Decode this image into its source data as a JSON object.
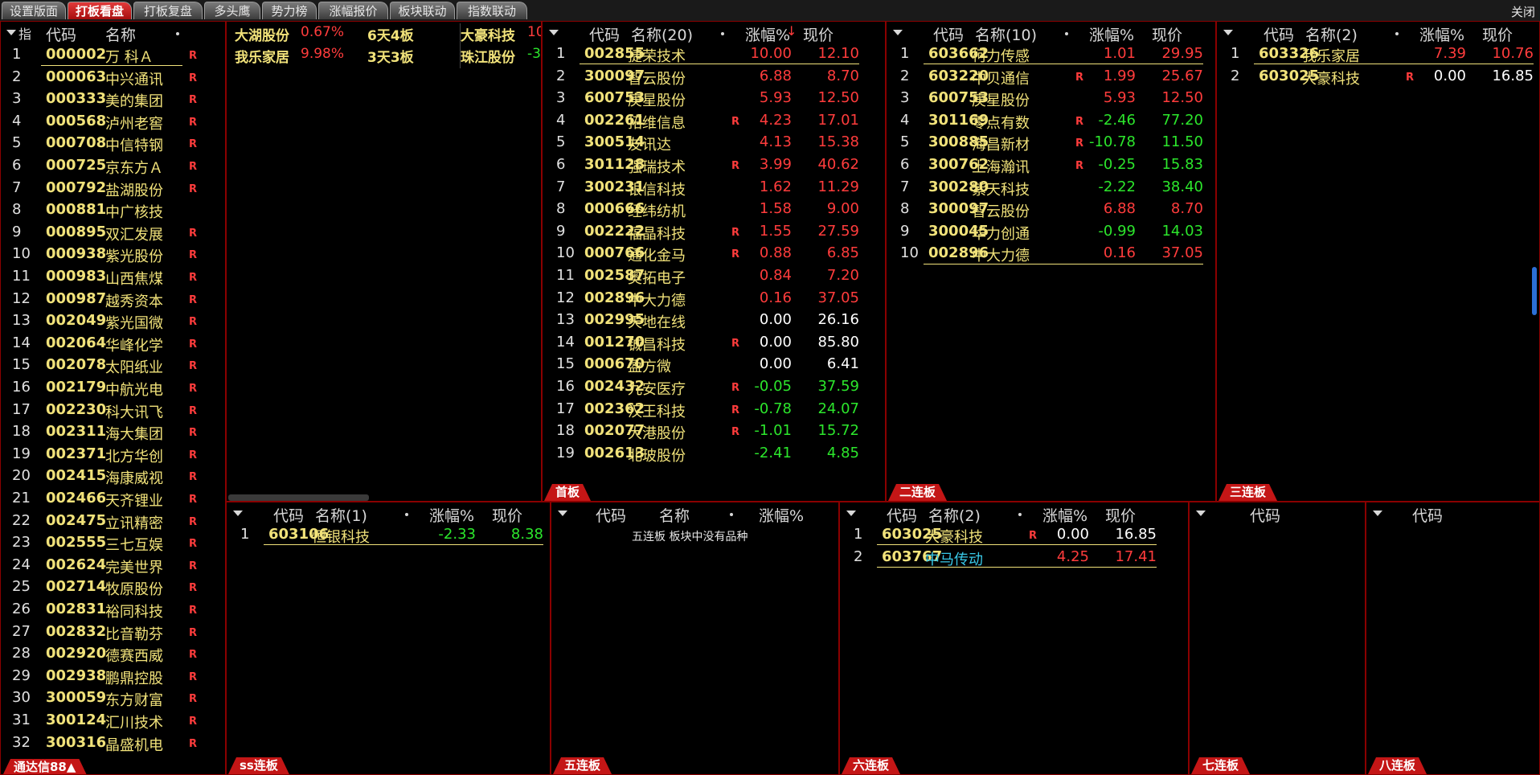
{
  "tabs": [
    "设置版面",
    "打板看盘",
    "打板复盘",
    "多头鹰",
    "势力榜",
    "涨幅报价",
    "板块联动",
    "指数联动"
  ],
  "close_label": "关闭",
  "left_list": {
    "hdr_idx": "指",
    "hdr_code": "代码",
    "hdr_name": "名称",
    "rows": [
      {
        "i": "1",
        "code": "000002",
        "name": "万 科Ａ",
        "r": "R"
      },
      {
        "i": "2",
        "code": "000063",
        "name": "中兴通讯",
        "r": "R"
      },
      {
        "i": "3",
        "code": "000333",
        "name": "美的集团",
        "r": "R"
      },
      {
        "i": "4",
        "code": "000568",
        "name": "泸州老窖",
        "r": "R"
      },
      {
        "i": "5",
        "code": "000708",
        "name": "中信特钢",
        "r": "R"
      },
      {
        "i": "6",
        "code": "000725",
        "name": "京东方Ａ",
        "r": "R"
      },
      {
        "i": "7",
        "code": "000792",
        "name": "盐湖股份",
        "r": "R"
      },
      {
        "i": "8",
        "code": "000881",
        "name": "中广核技",
        "r": ""
      },
      {
        "i": "9",
        "code": "000895",
        "name": "双汇发展",
        "r": "R"
      },
      {
        "i": "10",
        "code": "000938",
        "name": "紫光股份",
        "r": "R"
      },
      {
        "i": "11",
        "code": "000983",
        "name": "山西焦煤",
        "r": "R"
      },
      {
        "i": "12",
        "code": "000987",
        "name": "越秀资本",
        "r": "R"
      },
      {
        "i": "13",
        "code": "002049",
        "name": "紫光国微",
        "r": "R"
      },
      {
        "i": "14",
        "code": "002064",
        "name": "华峰化学",
        "r": "R"
      },
      {
        "i": "15",
        "code": "002078",
        "name": "太阳纸业",
        "r": "R"
      },
      {
        "i": "16",
        "code": "002179",
        "name": "中航光电",
        "r": "R"
      },
      {
        "i": "17",
        "code": "002230",
        "name": "科大讯飞",
        "r": "R"
      },
      {
        "i": "18",
        "code": "002311",
        "name": "海大集团",
        "r": "R"
      },
      {
        "i": "19",
        "code": "002371",
        "name": "北方华创",
        "r": "R"
      },
      {
        "i": "20",
        "code": "002415",
        "name": "海康威视",
        "r": "R"
      },
      {
        "i": "21",
        "code": "002466",
        "name": "天齐锂业",
        "r": "R"
      },
      {
        "i": "22",
        "code": "002475",
        "name": "立讯精密",
        "r": "R"
      },
      {
        "i": "23",
        "code": "002555",
        "name": "三七互娱",
        "r": "R"
      },
      {
        "i": "24",
        "code": "002624",
        "name": "完美世界",
        "r": "R"
      },
      {
        "i": "25",
        "code": "002714",
        "name": "牧原股份",
        "r": "R"
      },
      {
        "i": "26",
        "code": "002831",
        "name": "裕同科技",
        "r": "R"
      },
      {
        "i": "27",
        "code": "002832",
        "name": "比音勒芬",
        "r": "R"
      },
      {
        "i": "28",
        "code": "002920",
        "name": "德赛西威",
        "r": "R"
      },
      {
        "i": "29",
        "code": "002938",
        "name": "鹏鼎控股",
        "r": "R"
      },
      {
        "i": "30",
        "code": "300059",
        "name": "东方财富",
        "r": "R"
      },
      {
        "i": "31",
        "code": "300124",
        "name": "汇川技术",
        "r": "R"
      },
      {
        "i": "32",
        "code": "300316",
        "name": "晶盛机电",
        "r": "R"
      }
    ],
    "footer": "通达信88▲"
  },
  "ticker": {
    "rows": [
      [
        {
          "name": "大湖股份",
          "pct": "0.67%",
          "board": "6天4板"
        },
        {
          "name": "大豪科技",
          "pct": "10"
        }
      ],
      [
        {
          "name": "我乐家居",
          "pct": "9.98%",
          "board": "3天3板"
        },
        {
          "name": "珠江股份",
          "pct": "-3"
        }
      ]
    ]
  },
  "first_board": {
    "label": "首板",
    "hdr": {
      "code": "代码",
      "name": "名称(20)",
      "pct": "涨幅%",
      "price": "现价"
    },
    "rows": [
      {
        "i": "1",
        "code": "002855",
        "name": "捷荣技术",
        "r": "",
        "pct": "10.00",
        "price": "12.10",
        "c": "red"
      },
      {
        "i": "2",
        "code": "300097",
        "name": "智云股份",
        "r": "",
        "pct": "6.88",
        "price": "8.70",
        "c": "red"
      },
      {
        "i": "3",
        "code": "600753",
        "name": "庚星股份",
        "r": "",
        "pct": "5.93",
        "price": "12.50",
        "c": "red"
      },
      {
        "i": "4",
        "code": "002261",
        "name": "拓维信息",
        "r": "R",
        "pct": "4.23",
        "price": "17.01",
        "c": "red"
      },
      {
        "i": "5",
        "code": "300514",
        "name": "友讯达",
        "r": "",
        "pct": "4.13",
        "price": "15.38",
        "c": "red"
      },
      {
        "i": "6",
        "code": "301128",
        "name": "强瑞技术",
        "r": "R",
        "pct": "3.99",
        "price": "40.62",
        "c": "red"
      },
      {
        "i": "7",
        "code": "300231",
        "name": "银信科技",
        "r": "",
        "pct": "1.62",
        "price": "11.29",
        "c": "red"
      },
      {
        "i": "8",
        "code": "000666",
        "name": "经纬纺机",
        "r": "",
        "pct": "1.58",
        "price": "9.00",
        "c": "red"
      },
      {
        "i": "9",
        "code": "002222",
        "name": "福晶科技",
        "r": "R",
        "pct": "1.55",
        "price": "27.59",
        "c": "red"
      },
      {
        "i": "10",
        "code": "000766",
        "name": "通化金马",
        "r": "R",
        "pct": "0.88",
        "price": "6.85",
        "c": "red"
      },
      {
        "i": "11",
        "code": "002587",
        "name": "奥拓电子",
        "r": "",
        "pct": "0.84",
        "price": "7.20",
        "c": "red"
      },
      {
        "i": "12",
        "code": "002896",
        "name": "中大力德",
        "r": "",
        "pct": "0.16",
        "price": "37.05",
        "c": "red"
      },
      {
        "i": "13",
        "code": "002995",
        "name": "天地在线",
        "r": "",
        "pct": "0.00",
        "price": "26.16",
        "c": "white"
      },
      {
        "i": "14",
        "code": "001270",
        "name": "铖昌科技",
        "r": "R",
        "pct": "0.00",
        "price": "85.80",
        "c": "white"
      },
      {
        "i": "15",
        "code": "000670",
        "name": "盈方微",
        "r": "",
        "pct": "0.00",
        "price": "6.41",
        "c": "white"
      },
      {
        "i": "16",
        "code": "002432",
        "name": "九安医疗",
        "r": "R",
        "pct": "-0.05",
        "price": "37.59",
        "c": "green"
      },
      {
        "i": "17",
        "code": "002362",
        "name": "汉王科技",
        "r": "R",
        "pct": "-0.78",
        "price": "24.07",
        "c": "green"
      },
      {
        "i": "18",
        "code": "002077",
        "name": "大港股份",
        "r": "R",
        "pct": "-1.01",
        "price": "15.72",
        "c": "green"
      },
      {
        "i": "19",
        "code": "002613",
        "name": "北玻股份",
        "r": "",
        "pct": "-2.41",
        "price": "4.85",
        "c": "green"
      }
    ]
  },
  "second_board": {
    "label": "二连板",
    "hdr": {
      "code": "代码",
      "name": "名称(10)",
      "pct": "涨幅%",
      "price": "现价"
    },
    "rows": [
      {
        "i": "1",
        "code": "603662",
        "name": "柯力传感",
        "r": "",
        "pct": "1.01",
        "price": "29.95",
        "c": "red"
      },
      {
        "i": "2",
        "code": "603220",
        "name": "中贝通信",
        "r": "R",
        "pct": "1.99",
        "price": "25.67",
        "c": "red"
      },
      {
        "i": "3",
        "code": "600753",
        "name": "庚星股份",
        "r": "",
        "pct": "5.93",
        "price": "12.50",
        "c": "red"
      },
      {
        "i": "4",
        "code": "301169",
        "name": "零点有数",
        "r": "R",
        "pct": "-2.46",
        "price": "77.20",
        "c": "green"
      },
      {
        "i": "5",
        "code": "300885",
        "name": "海昌新材",
        "r": "R",
        "pct": "-10.78",
        "price": "11.50",
        "c": "green"
      },
      {
        "i": "6",
        "code": "300762",
        "name": "上海瀚讯",
        "r": "R",
        "pct": "-0.25",
        "price": "15.83",
        "c": "green"
      },
      {
        "i": "7",
        "code": "300280",
        "name": "紫天科技",
        "r": "",
        "pct": "-2.22",
        "price": "38.40",
        "c": "green"
      },
      {
        "i": "8",
        "code": "300097",
        "name": "智云股份",
        "r": "",
        "pct": "6.88",
        "price": "8.70",
        "c": "red"
      },
      {
        "i": "9",
        "code": "300045",
        "name": "华力创通",
        "r": "",
        "pct": "-0.99",
        "price": "14.03",
        "c": "green"
      },
      {
        "i": "10",
        "code": "002896",
        "name": "中大力德",
        "r": "",
        "pct": "0.16",
        "price": "37.05",
        "c": "red"
      }
    ]
  },
  "third_board": {
    "label": "三连板",
    "hdr": {
      "code": "代码",
      "name": "名称(2)",
      "pct": "涨幅%",
      "price": "现价"
    },
    "rows": [
      {
        "i": "1",
        "code": "603326",
        "name": "我乐家居",
        "r": "",
        "pct": "7.39",
        "price": "10.76",
        "c": "red"
      },
      {
        "i": "2",
        "code": "603025",
        "name": "大豪科技",
        "r": "R",
        "pct": "0.00",
        "price": "16.85",
        "c": "white"
      }
    ]
  },
  "ss_board": {
    "label": "ss连板",
    "hdr": {
      "code": "代码",
      "name": "名称(1)",
      "pct": "涨幅%",
      "price": "现价"
    },
    "rows": [
      {
        "i": "1",
        "code": "603106",
        "name": "恒银科技",
        "r": "",
        "pct": "-2.33",
        "price": "8.38",
        "c": "green"
      }
    ]
  },
  "fifth_board": {
    "label": "五连板",
    "hdr": {
      "code": "代码",
      "name": "名称",
      "pct": "涨幅%"
    },
    "empty_msg": "五连板 板块中没有品种"
  },
  "sixth_board": {
    "label": "六连板",
    "hdr": {
      "code": "代码",
      "name": "名称(2)",
      "pct": "涨幅%",
      "price": "现价"
    },
    "rows": [
      {
        "i": "1",
        "code": "603025",
        "name": "大豪科技",
        "r": "R",
        "pct": "0.00",
        "price": "16.85",
        "c": "white",
        "nc": "yellow"
      },
      {
        "i": "2",
        "code": "603767",
        "name": "中马传动",
        "r": "",
        "pct": "4.25",
        "price": "17.41",
        "c": "red",
        "nc": "cyan"
      }
    ]
  },
  "seventh_board": {
    "label": "七连板",
    "hdr": {
      "code": "代码"
    }
  },
  "eighth_board": {
    "label": "八连板",
    "hdr": {
      "code": "代码"
    }
  },
  "colors": {
    "up": "#ff3c3c",
    "down": "#2ce62c",
    "flat": "#ffffff",
    "code": "#f1e27a",
    "border": "#8a0000"
  }
}
